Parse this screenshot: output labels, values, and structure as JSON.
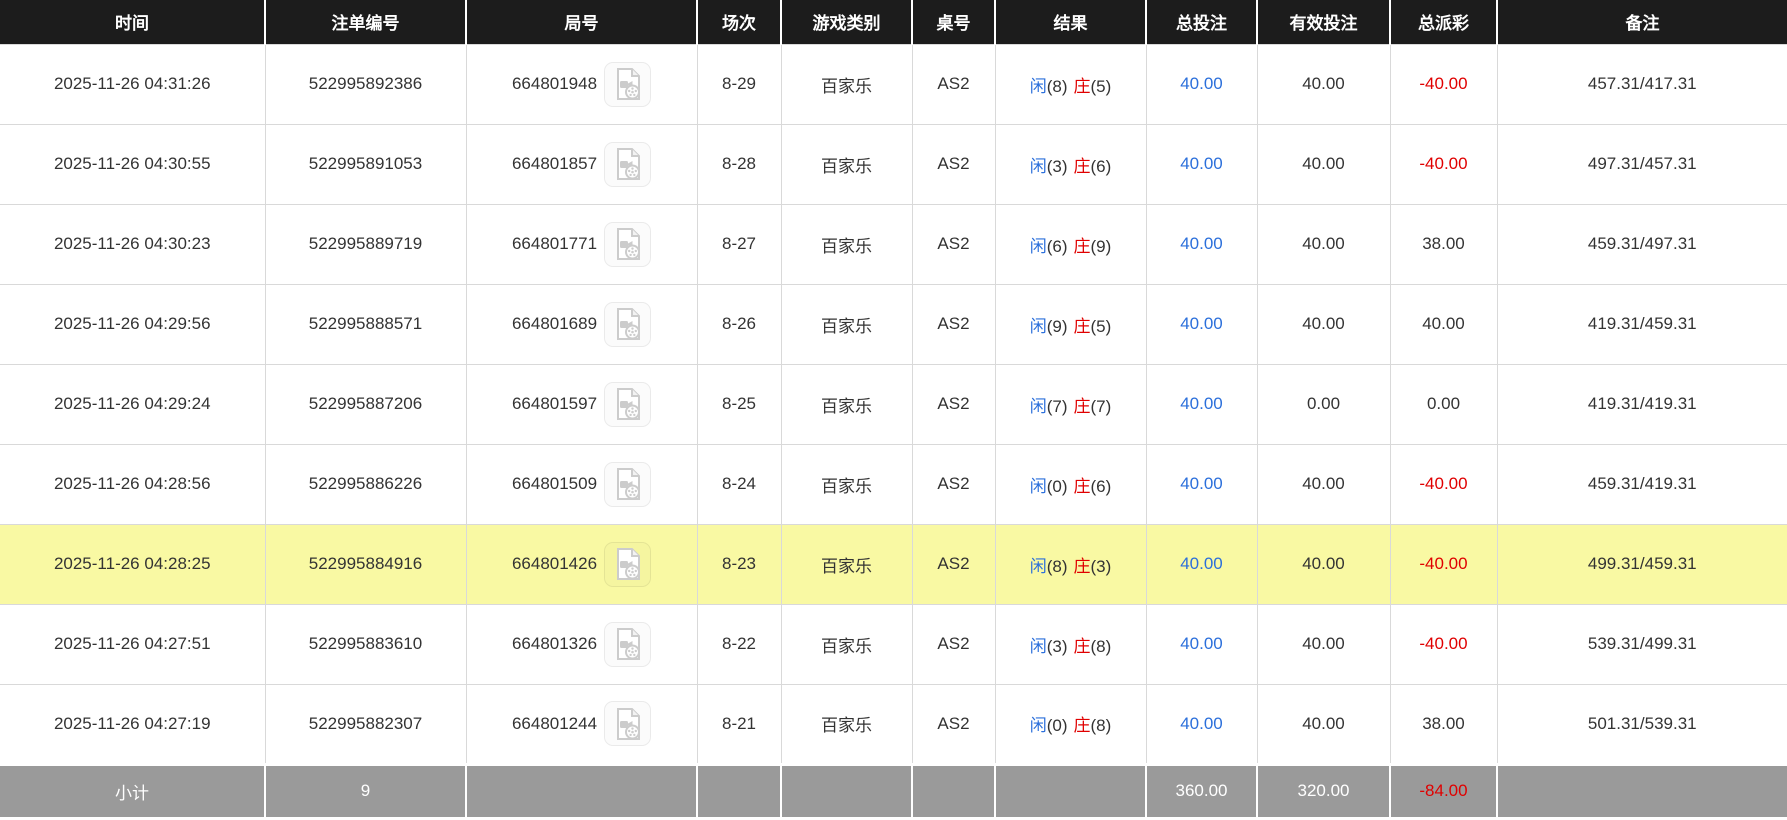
{
  "colors": {
    "header_bg": "#1c1c1c",
    "text": "#333333",
    "border": "#d9d9d9",
    "blue": "#2b6fdb",
    "red": "#e00000",
    "highlight": "#f9f9a3",
    "footer_bg": "#9a9a9a",
    "row_bg": "#ffffff"
  },
  "icons": {
    "round_video": "video-file-icon"
  },
  "table": {
    "columns": [
      {
        "label": "时间"
      },
      {
        "label": "注单编号"
      },
      {
        "label": "局号"
      },
      {
        "label": "场次"
      },
      {
        "label": "游戏类别"
      },
      {
        "label": "桌号"
      },
      {
        "label": "结果"
      },
      {
        "label": "总投注"
      },
      {
        "label": "有效投注"
      },
      {
        "label": "总派彩"
      },
      {
        "label": "备注"
      }
    ],
    "rows": [
      {
        "time": "2025-11-26 04:31:26",
        "bet_id": "522995892386",
        "round_id": "664801948",
        "session": "8-29",
        "game_type": "百家乐",
        "table_id": "AS2",
        "result_player": "闲",
        "result_player_score": "(8)",
        "result_banker": "庄",
        "result_banker_score": "(5)",
        "total_bet": "40.00",
        "valid_bet": "40.00",
        "total_payout": "-40.00",
        "remark": "457.31/417.31",
        "highlighted": false
      },
      {
        "time": "2025-11-26 04:30:55",
        "bet_id": "522995891053",
        "round_id": "664801857",
        "session": "8-28",
        "game_type": "百家乐",
        "table_id": "AS2",
        "result_player": "闲",
        "result_player_score": "(3)",
        "result_banker": "庄",
        "result_banker_score": "(6)",
        "total_bet": "40.00",
        "valid_bet": "40.00",
        "total_payout": "-40.00",
        "remark": "497.31/457.31",
        "highlighted": false
      },
      {
        "time": "2025-11-26 04:30:23",
        "bet_id": "522995889719",
        "round_id": "664801771",
        "session": "8-27",
        "game_type": "百家乐",
        "table_id": "AS2",
        "result_player": "闲",
        "result_player_score": "(6)",
        "result_banker": "庄",
        "result_banker_score": "(9)",
        "total_bet": "40.00",
        "valid_bet": "40.00",
        "total_payout": "38.00",
        "remark": "459.31/497.31",
        "highlighted": false
      },
      {
        "time": "2025-11-26 04:29:56",
        "bet_id": "522995888571",
        "round_id": "664801689",
        "session": "8-26",
        "game_type": "百家乐",
        "table_id": "AS2",
        "result_player": "闲",
        "result_player_score": "(9)",
        "result_banker": "庄",
        "result_banker_score": "(5)",
        "total_bet": "40.00",
        "valid_bet": "40.00",
        "total_payout": "40.00",
        "remark": "419.31/459.31",
        "highlighted": false
      },
      {
        "time": "2025-11-26 04:29:24",
        "bet_id": "522995887206",
        "round_id": "664801597",
        "session": "8-25",
        "game_type": "百家乐",
        "table_id": "AS2",
        "result_player": "闲",
        "result_player_score": "(7)",
        "result_banker": "庄",
        "result_banker_score": "(7)",
        "total_bet": "40.00",
        "valid_bet": "0.00",
        "total_payout": "0.00",
        "remark": "419.31/419.31",
        "highlighted": false
      },
      {
        "time": "2025-11-26 04:28:56",
        "bet_id": "522995886226",
        "round_id": "664801509",
        "session": "8-24",
        "game_type": "百家乐",
        "table_id": "AS2",
        "result_player": "闲",
        "result_player_score": "(0)",
        "result_banker": "庄",
        "result_banker_score": "(6)",
        "total_bet": "40.00",
        "valid_bet": "40.00",
        "total_payout": "-40.00",
        "remark": "459.31/419.31",
        "highlighted": false
      },
      {
        "time": "2025-11-26 04:28:25",
        "bet_id": "522995884916",
        "round_id": "664801426",
        "session": "8-23",
        "game_type": "百家乐",
        "table_id": "AS2",
        "result_player": "闲",
        "result_player_score": "(8)",
        "result_banker": "庄",
        "result_banker_score": "(3)",
        "total_bet": "40.00",
        "valid_bet": "40.00",
        "total_payout": "-40.00",
        "remark": "499.31/459.31",
        "highlighted": true
      },
      {
        "time": "2025-11-26 04:27:51",
        "bet_id": "522995883610",
        "round_id": "664801326",
        "session": "8-22",
        "game_type": "百家乐",
        "table_id": "AS2",
        "result_player": "闲",
        "result_player_score": "(3)",
        "result_banker": "庄",
        "result_banker_score": "(8)",
        "total_bet": "40.00",
        "valid_bet": "40.00",
        "total_payout": "-40.00",
        "remark": "539.31/499.31",
        "highlighted": false
      },
      {
        "time": "2025-11-26 04:27:19",
        "bet_id": "522995882307",
        "round_id": "664801244",
        "session": "8-21",
        "game_type": "百家乐",
        "table_id": "AS2",
        "result_player": "闲",
        "result_player_score": "(0)",
        "result_banker": "庄",
        "result_banker_score": "(8)",
        "total_bet": "40.00",
        "valid_bet": "40.00",
        "total_payout": "38.00",
        "remark": "501.31/539.31",
        "highlighted": false
      }
    ],
    "summary": {
      "label": "小计",
      "count": "9",
      "total_bet": "360.00",
      "valid_bet": "320.00",
      "total_payout": "-84.00"
    }
  }
}
